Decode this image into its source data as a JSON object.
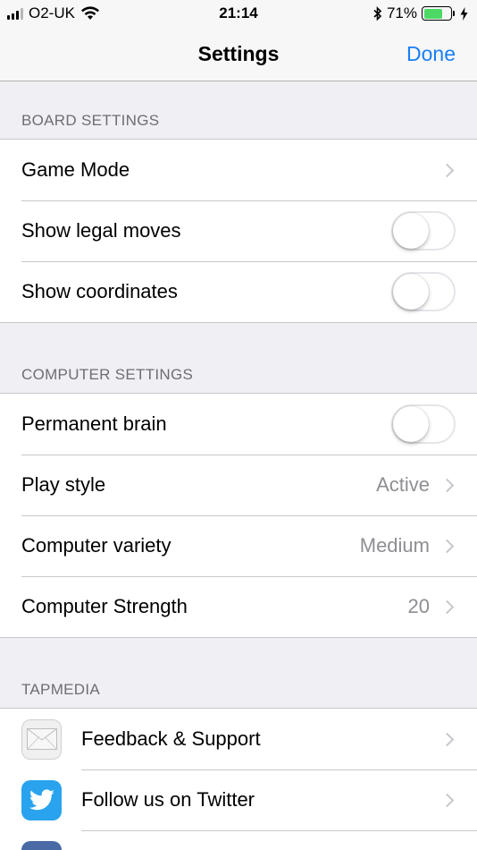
{
  "status_bar": {
    "carrier": "O2-UK",
    "time": "21:14",
    "battery_percent": "71%",
    "battery_level": 0.71
  },
  "nav": {
    "title": "Settings",
    "done_label": "Done"
  },
  "sections": {
    "board": {
      "header": "BOARD SETTINGS",
      "game_mode": "Game Mode",
      "show_legal_moves": "Show legal moves",
      "show_legal_moves_on": false,
      "show_coordinates": "Show coordinates",
      "show_coordinates_on": false
    },
    "computer": {
      "header": "COMPUTER SETTINGS",
      "permanent_brain": "Permanent brain",
      "permanent_brain_on": false,
      "play_style": "Play style",
      "play_style_value": "Active",
      "variety": "Computer variety",
      "variety_value": "Medium",
      "strength": "Computer Strength",
      "strength_value": "20"
    },
    "tapmedia": {
      "header": "TAPMEDIA",
      "feedback": "Feedback & Support",
      "twitter": "Follow us on Twitter"
    }
  },
  "colors": {
    "accent": "#1a7ef5",
    "twitter": "#2aa3ef",
    "battery": "#4cd964"
  }
}
